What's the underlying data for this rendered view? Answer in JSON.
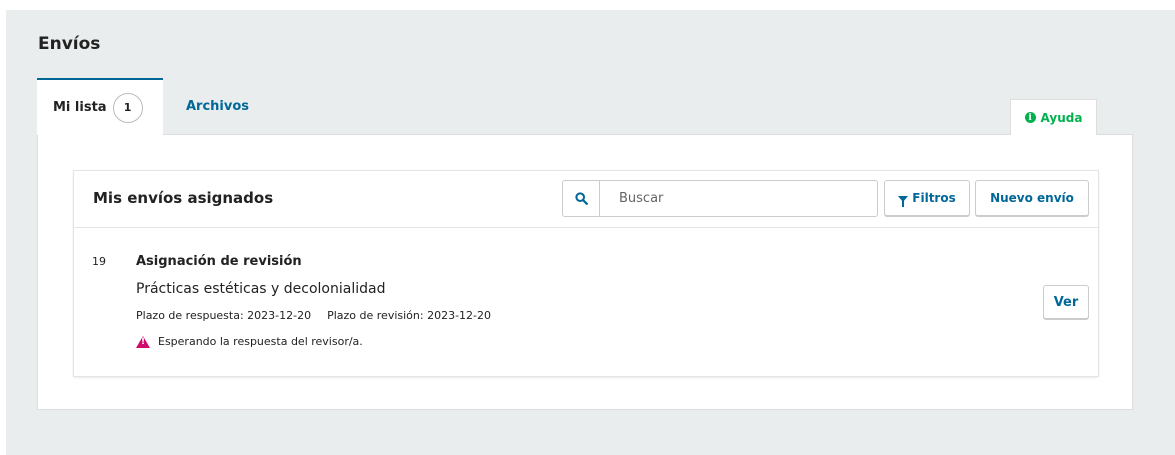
{
  "page": {
    "title": "Envíos"
  },
  "tabs": {
    "my_list_label": "Mi lista",
    "my_list_count": "1",
    "archives_label": "Archivos"
  },
  "help": {
    "label": "Ayuda",
    "icon": "info-circle-icon"
  },
  "panel": {
    "title": "Mis envíos asignados",
    "search_placeholder": "Buscar",
    "search_value": "",
    "filters_label": "Filtros",
    "new_submission_label": "Nuevo envío"
  },
  "item": {
    "id": "19",
    "type": "Asignación de revisión",
    "title": "Prácticas estéticas y decolonialidad",
    "response_due": "Plazo de respuesta: 2023-12-20",
    "review_due": "Plazo de revisión: 2023-12-20",
    "status": "Esperando la respuesta del revisor/a.",
    "view_label": "Ver"
  },
  "colors": {
    "accent": "#006798",
    "help_green": "#00b24e",
    "warning": "#d00a6c",
    "background": "#eaedee"
  }
}
